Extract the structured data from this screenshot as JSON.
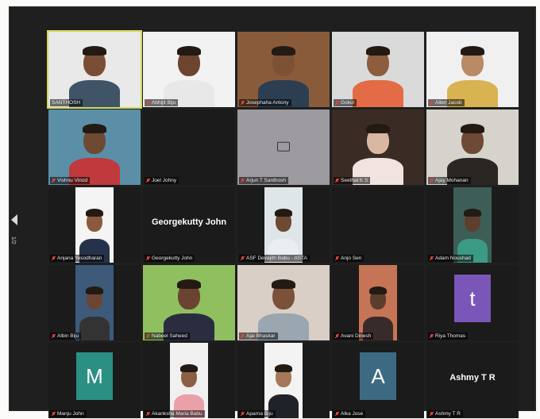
{
  "meeting": {
    "gallery": [
      {
        "name": "SANTHOSH",
        "muted": false,
        "type": "video",
        "bg": "#e9e9e9",
        "skin": "#7a4e34",
        "shirt": "#3f5466",
        "active": true
      },
      {
        "name": "Abhijit Biju",
        "muted": true,
        "type": "video",
        "bg": "#f2f2f2",
        "skin": "#6d4430",
        "shirt": "#e8e8e8"
      },
      {
        "name": "Josephaha Antony",
        "muted": true,
        "type": "video",
        "bg": "#8a5b3b",
        "skin": "#7d5136",
        "shirt": "#2c3e52"
      },
      {
        "name": "Gokul",
        "muted": true,
        "type": "video",
        "bg": "#dadada",
        "skin": "#8c5d3e",
        "shirt": "#e36b45"
      },
      {
        "name": "Allen Jacob",
        "muted": true,
        "type": "video",
        "bg": "#f0f0f0",
        "skin": "#b88a66",
        "shirt": "#d9b252"
      },
      {
        "name": "Vishnu Vinod",
        "muted": true,
        "type": "video",
        "bg": "#5b8fa8",
        "skin": "#6e4a33",
        "shirt": "#c0393c"
      },
      {
        "name": "Joel Johny",
        "muted": true,
        "type": "blank"
      },
      {
        "name": "Arjun T Santhosh",
        "muted": true,
        "type": "camoff",
        "bg": "#9d9aa0"
      },
      {
        "name": "Seethal K S",
        "muted": true,
        "type": "video",
        "bg": "#3b2b25",
        "skin": "#d9b7a2",
        "shirt": "#f1e3e0"
      },
      {
        "name": "Ajay Mohanan",
        "muted": true,
        "type": "video",
        "bg": "#d6d3cd",
        "skin": "#6d4a35",
        "shirt": "#2a2622"
      },
      {
        "name": "Anjana Yesodharan",
        "muted": true,
        "type": "video",
        "bg": "#f4f4f4",
        "skin": "#8a5a3d",
        "shirt": "#25324a",
        "narrow": true
      },
      {
        "name": "Georgekutty John",
        "muted": true,
        "type": "text",
        "label": "Georgekutty John"
      },
      {
        "name": "ASF Devajith Babu - ASTA",
        "muted": true,
        "type": "video",
        "bg": "#dfe6e8",
        "skin": "#6e4a34",
        "shirt": "#e9eef2",
        "narrow": true
      },
      {
        "name": "Anjo Sen",
        "muted": true,
        "type": "blank"
      },
      {
        "name": "Adam Noushad",
        "muted": true,
        "type": "video",
        "bg": "#3d5e57",
        "skin": "#5e3f2d",
        "shirt": "#3a9a84",
        "narrow": true
      },
      {
        "name": "Albin Biju",
        "muted": true,
        "type": "video",
        "bg": "#3d5a7a",
        "skin": "#6a4632",
        "shirt": "#333",
        "narrow": true
      },
      {
        "name": "Nabeel Saheed",
        "muted": true,
        "type": "video",
        "bg": "#8fbf5f",
        "skin": "#6a4431",
        "shirt": "#2a2d40"
      },
      {
        "name": "Ajai Bhaskar",
        "muted": true,
        "type": "video",
        "bg": "#d9cfc6",
        "skin": "#7b5139",
        "shirt": "#9aa6b0"
      },
      {
        "name": "Avani Dinesh",
        "muted": true,
        "type": "video",
        "bg": "#c57556",
        "skin": "#5b3d2c",
        "shirt": "#3a2b2b",
        "narrow": true
      },
      {
        "name": "Riya Thomas",
        "muted": true,
        "type": "avatar",
        "letter": "t",
        "color": "#7a56b8"
      },
      {
        "name": "Manju John",
        "muted": true,
        "type": "avatar",
        "letter": "M",
        "color": "#2b8f83"
      },
      {
        "name": "Akanksha Maria Babu",
        "muted": true,
        "type": "video",
        "bg": "#f0f0f0",
        "skin": "#8c5f45",
        "shirt": "#e9a0a9",
        "narrow": true
      },
      {
        "name": "Aparna Biju",
        "muted": true,
        "type": "video",
        "bg": "#f3f3f3",
        "skin": "#a5775b",
        "shirt": "#20222a",
        "narrow": true
      },
      {
        "name": "Alka Jose",
        "muted": true,
        "type": "avatar",
        "letter": "A",
        "color": "#3d6a82"
      },
      {
        "name": "Ashmy T R",
        "muted": true,
        "type": "text",
        "label": "Ashmy T R"
      }
    ]
  },
  "sidebar": {
    "page_indicator": "1/2"
  }
}
